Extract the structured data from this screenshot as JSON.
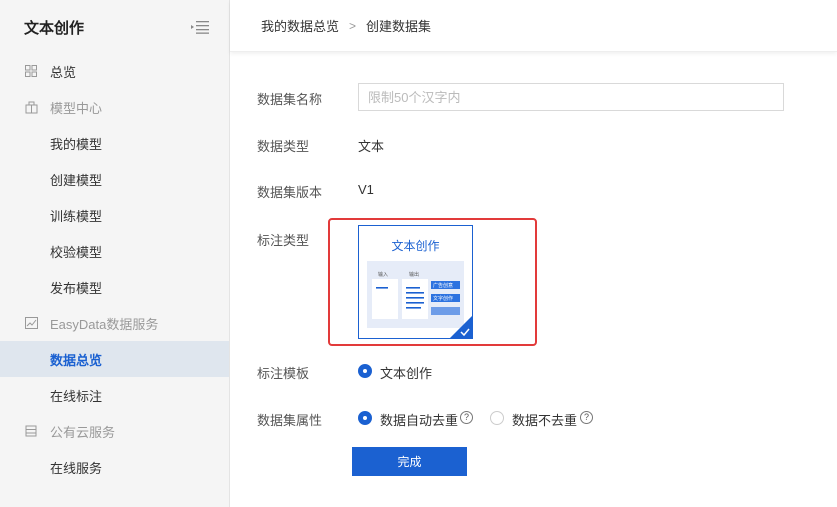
{
  "sidebar": {
    "title": "文本创作",
    "items": [
      {
        "label": "总览"
      },
      {
        "label": "模型中心"
      },
      {
        "label": "我的模型"
      },
      {
        "label": "创建模型"
      },
      {
        "label": "训练模型"
      },
      {
        "label": "校验模型"
      },
      {
        "label": "发布模型"
      },
      {
        "label": "EasyData数据服务"
      },
      {
        "label": "数据总览"
      },
      {
        "label": "在线标注"
      },
      {
        "label": "公有云服务"
      },
      {
        "label": "在线服务"
      }
    ]
  },
  "breadcrumb": {
    "parent": "我的数据总览",
    "separator": ">",
    "current": "创建数据集"
  },
  "form": {
    "name_label": "数据集名称",
    "name_placeholder": "限制50个汉字内",
    "name_value": "",
    "type_label": "数据类型",
    "type_value": "文本",
    "version_label": "数据集版本",
    "version_value": "V1",
    "annotation_type_label": "标注类型",
    "annotation_card": {
      "title": "文本创作",
      "input_caption": "输入",
      "output_caption": "输出",
      "tag_1": "广告创意",
      "tag_2": "文字创作",
      "selected": true
    },
    "template_label": "标注模板",
    "template_option": "文本创作",
    "attribute_label": "数据集属性",
    "attribute_options": [
      {
        "label": "数据自动去重",
        "checked": true
      },
      {
        "label": "数据不去重",
        "checked": false
      }
    ],
    "help_glyph": "?",
    "submit_label": "完成"
  },
  "colors": {
    "accent": "#1b61d1",
    "highlight": "#e23a3a",
    "sidebar_bg": "#f5f5f5",
    "active_bg": "#dfe6ee"
  }
}
